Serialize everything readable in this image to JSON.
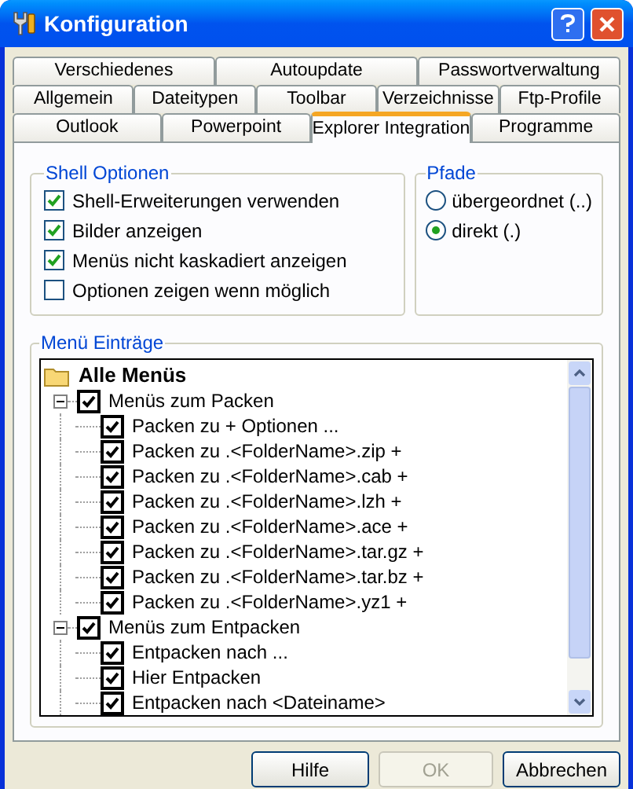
{
  "window": {
    "title": "Konfiguration"
  },
  "tab_rows": [
    [
      {
        "label": "Verschiedenes",
        "selected": false
      },
      {
        "label": "Autoupdate",
        "selected": false
      },
      {
        "label": "Passwortverwaltung",
        "selected": false
      }
    ],
    [
      {
        "label": "Allgemein",
        "selected": false
      },
      {
        "label": "Dateitypen",
        "selected": false
      },
      {
        "label": "Toolbar",
        "selected": false
      },
      {
        "label": "Verzeichnisse",
        "selected": false
      },
      {
        "label": "Ftp-Profile",
        "selected": false
      }
    ],
    [
      {
        "label": "Outlook",
        "selected": false
      },
      {
        "label": "Powerpoint",
        "selected": false
      },
      {
        "label": "Explorer Integration",
        "selected": true
      },
      {
        "label": "Programme",
        "selected": false
      }
    ]
  ],
  "shell_options": {
    "title": "Shell Optionen",
    "items": [
      {
        "label": "Shell-Erweiterungen verwenden",
        "checked": true
      },
      {
        "label": "Bilder anzeigen",
        "checked": true
      },
      {
        "label": "Menüs nicht kaskadiert anzeigen",
        "checked": true
      },
      {
        "label": "Optionen zeigen wenn möglich",
        "checked": false
      }
    ]
  },
  "paths": {
    "title": "Pfade",
    "items": [
      {
        "label": "übergeordnet (..)",
        "selected": false
      },
      {
        "label": "direkt (.)",
        "selected": true
      }
    ]
  },
  "menu_entries": {
    "title": "Menü Einträge",
    "tree": {
      "label": "Alle Menüs",
      "children": [
        {
          "label": "Menüs zum Packen",
          "checked": true,
          "expanded": true,
          "children": [
            {
              "label": "Packen zu + Optionen ...",
              "checked": true
            },
            {
              "label": "Packen zu .<FolderName>.zip +",
              "checked": true
            },
            {
              "label": "Packen zu .<FolderName>.cab +",
              "checked": true
            },
            {
              "label": "Packen zu .<FolderName>.lzh +",
              "checked": true
            },
            {
              "label": "Packen zu .<FolderName>.ace +",
              "checked": true
            },
            {
              "label": "Packen zu .<FolderName>.tar.gz +",
              "checked": true
            },
            {
              "label": "Packen zu .<FolderName>.tar.bz +",
              "checked": true
            },
            {
              "label": "Packen zu .<FolderName>.yz1 +",
              "checked": true
            }
          ]
        },
        {
          "label": "Menüs zum Entpacken",
          "checked": true,
          "expanded": true,
          "children": [
            {
              "label": "Entpacken nach ...",
              "checked": true
            },
            {
              "label": "Hier Entpacken",
              "checked": true
            },
            {
              "label": "Entpacken nach <Dateiname>",
              "checked": true
            }
          ]
        }
      ]
    }
  },
  "buttons": [
    {
      "label": "Hilfe",
      "disabled": false
    },
    {
      "label": "OK",
      "disabled": true
    },
    {
      "label": "Abbrechen",
      "disabled": false
    }
  ]
}
